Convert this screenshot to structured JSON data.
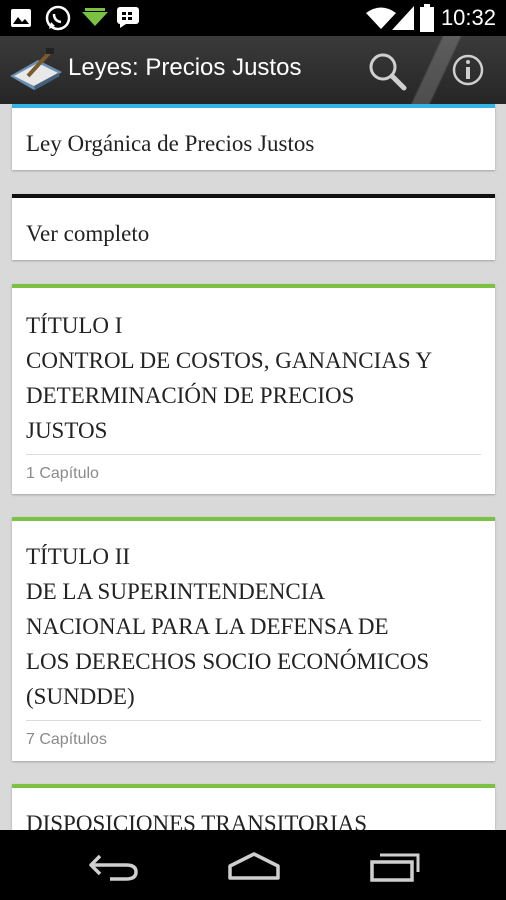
{
  "status_bar": {
    "time": "10:32",
    "icons": [
      "image-icon",
      "whatsapp-icon",
      "download-arrow-icon",
      "bbm-icon",
      "wifi-icon",
      "signal-icon",
      "battery-icon"
    ]
  },
  "action_bar": {
    "title": "Leyes: Precios Justos",
    "icons": [
      "app-logo-icon",
      "search-icon",
      "info-icon"
    ]
  },
  "colors": {
    "accent_blue": "#33b5e5",
    "accent_black": "#111111",
    "accent_green": "#7cc242"
  },
  "cards": [
    {
      "title": "Ley Orgánica de Precios Justos"
    },
    {
      "title": "Ver completo"
    },
    {
      "lines": [
        "TÍTULO I",
        "CONTROL DE COSTOS, GANANCIAS Y",
        "DETERMINACIÓN DE PRECIOS",
        "JUSTOS"
      ],
      "subtitle": "1 Capítulo"
    },
    {
      "lines": [
        "TÍTULO II",
        "DE LA SUPERINTENDENCIA",
        "NACIONAL PARA LA DEFENSA DE",
        "LOS DERECHOS SOCIO ECONÓMICOS",
        "(SUNDDE)"
      ],
      "subtitle": "7 Capítulos"
    },
    {
      "lines": [
        "DISPOSICIONES TRANSITORIAS"
      ]
    }
  ],
  "nav_bar": {
    "icons": [
      "back-icon",
      "home-icon",
      "recent-apps-icon"
    ]
  }
}
